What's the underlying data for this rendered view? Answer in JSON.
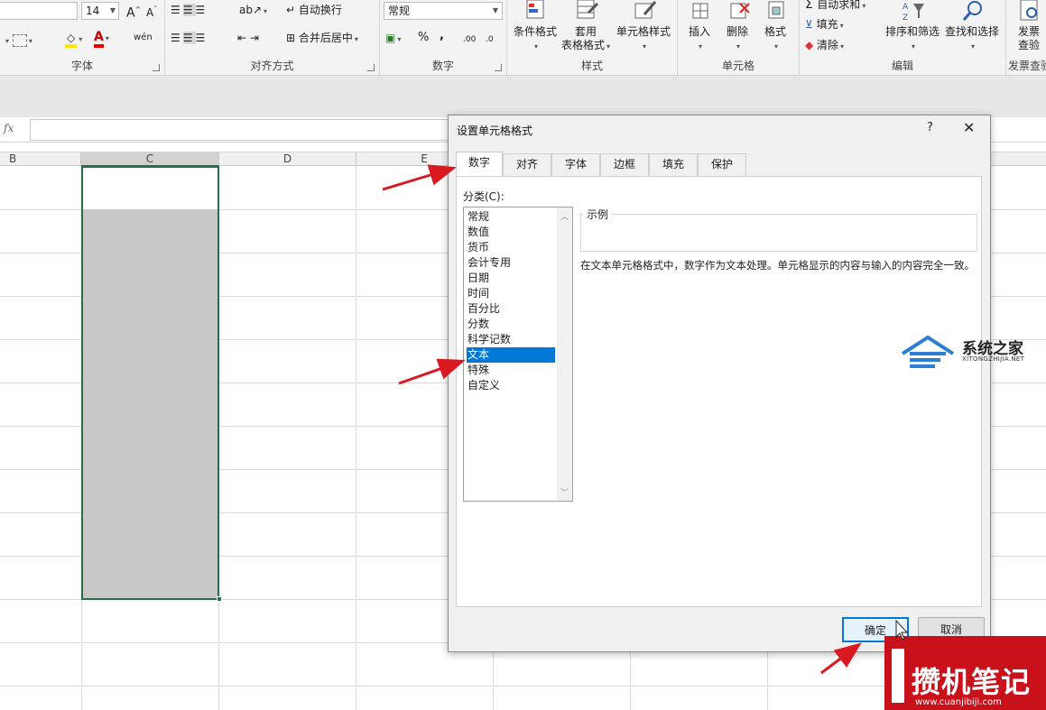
{
  "ribbon": {
    "font_size": "14",
    "wrap_text": "自动换行",
    "merge_center": "合并后居中",
    "number_format": "常规",
    "cond_format": "条件格式",
    "table_format_1": "套用",
    "table_format_2": "表格格式",
    "cell_styles": "单元格样式",
    "insert": "插入",
    "delete": "删除",
    "format": "格式",
    "autosum": "自动求和",
    "fill": "填充",
    "clear": "清除",
    "sort_filter": "排序和筛选",
    "find_select": "查找和选择",
    "invoice_1": "发票",
    "invoice_2": "查验",
    "group_font": "字体",
    "group_align": "对齐方式",
    "group_number": "数字",
    "group_styles": "样式",
    "group_cells": "单元格",
    "group_edit": "编辑",
    "group_invoice": "发票查验",
    "percent": "%",
    "comma": ",",
    "inc_decimal": ".00",
    "dec_decimal": ".0"
  },
  "formula_bar": {
    "fx": "fx",
    "value": ""
  },
  "columns": [
    "B",
    "C",
    "D",
    "E"
  ],
  "dialog": {
    "title": "设置单元格格式",
    "help": "?",
    "close": "✕",
    "tabs": [
      "数字",
      "对齐",
      "字体",
      "边框",
      "填充",
      "保护"
    ],
    "active_tab": "数字",
    "category_label": "分类(C):",
    "categories": [
      "常规",
      "数值",
      "货币",
      "会计专用",
      "日期",
      "时间",
      "百分比",
      "分数",
      "科学记数",
      "文本",
      "特殊",
      "自定义"
    ],
    "selected_category": "文本",
    "sample_label": "示例",
    "description": "在文本单元格格式中，数字作为文本处理。单元格显示的内容与输入的内容完全一致。",
    "ok": "确定",
    "cancel": "取消"
  },
  "watermarks": {
    "site1_title": "系统之家",
    "site1_url": "XITONGZHIJIA.NET",
    "site2_title": "攒机笔记",
    "site2_url": "www.cuanjibiji.com"
  },
  "colors": {
    "accent": "#0078d7",
    "selection": "#217346",
    "arrow": "#d9191f",
    "watermark_red": "#c8111a"
  }
}
